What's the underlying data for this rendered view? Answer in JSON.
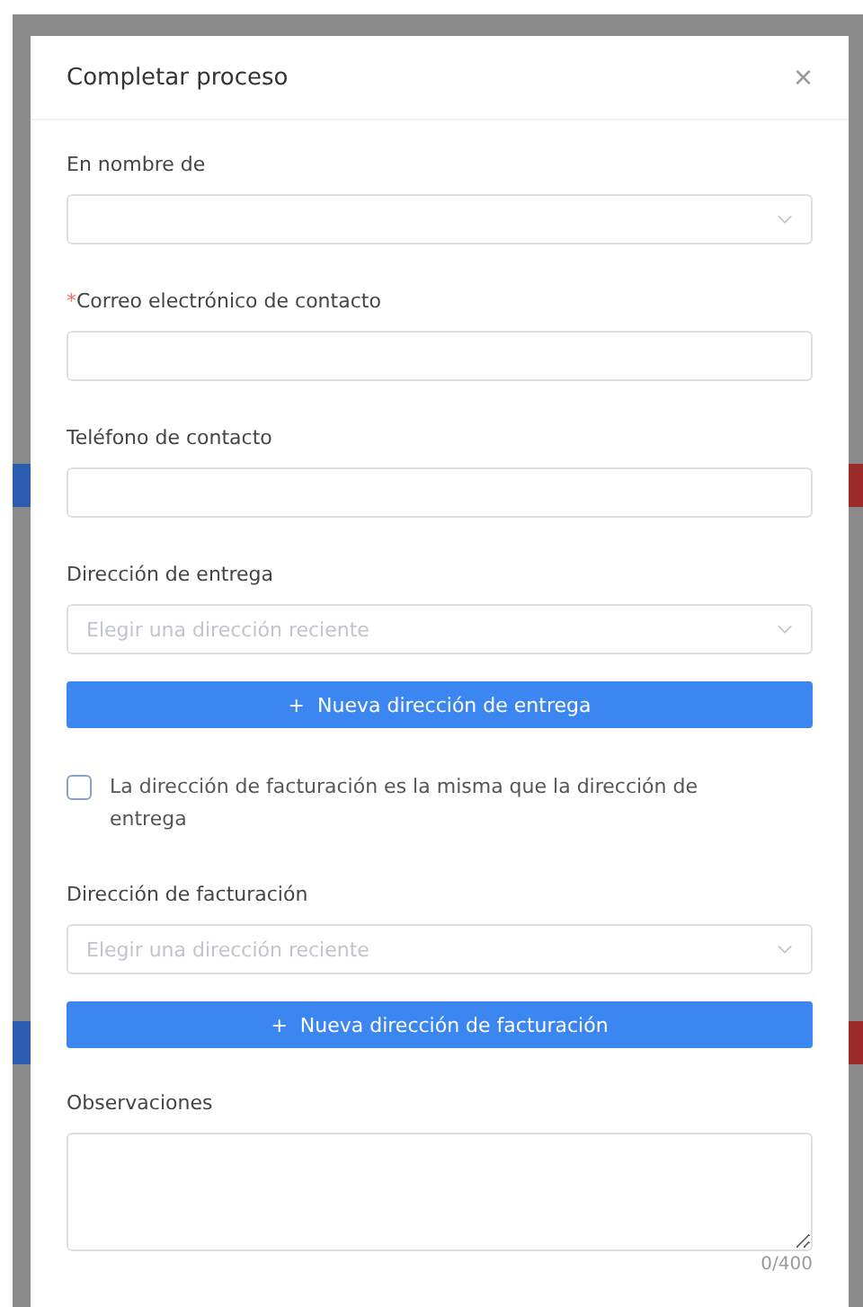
{
  "dialog": {
    "title": "Completar proceso",
    "close": "×"
  },
  "fields": [
    {
      "kind": "select",
      "label": "En nombre de"
    },
    {
      "kind": "input",
      "label": "Correo electrónico de contacto",
      "required_mark": "*"
    },
    {
      "kind": "input",
      "label": "Teléfono de contacto"
    },
    {
      "kind": "select",
      "label": "Dirección de entrega",
      "placeholder": "Elegir una dirección reciente"
    },
    {
      "kind": "button",
      "icon": "+",
      "label": "Nueva dirección de entrega"
    },
    {
      "kind": "checkbox",
      "label": "La dirección de facturación es la misma que la dirección de entrega",
      "checked": false
    },
    {
      "kind": "select",
      "label": "Dirección de facturación",
      "placeholder": "Elegir una dirección reciente"
    },
    {
      "kind": "button",
      "icon": "+",
      "label": "Nueva dirección de facturación"
    },
    {
      "kind": "textarea",
      "label": "Observaciones",
      "counter": "0/400"
    }
  ]
}
